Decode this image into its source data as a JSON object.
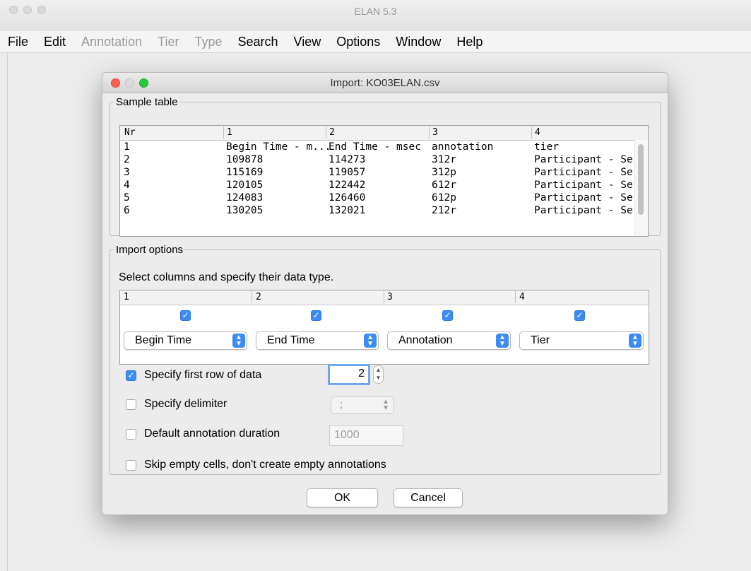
{
  "window": {
    "title": "ELAN 5.3",
    "menu": [
      {
        "label": "File",
        "enabled": true
      },
      {
        "label": "Edit",
        "enabled": true
      },
      {
        "label": "Annotation",
        "enabled": false
      },
      {
        "label": "Tier",
        "enabled": false
      },
      {
        "label": "Type",
        "enabled": false
      },
      {
        "label": "Search",
        "enabled": true
      },
      {
        "label": "View",
        "enabled": true
      },
      {
        "label": "Options",
        "enabled": true
      },
      {
        "label": "Window",
        "enabled": true
      },
      {
        "label": "Help",
        "enabled": true
      }
    ]
  },
  "dialog": {
    "title": "Import: KO03ELAN.csv",
    "sample_table": {
      "legend": "Sample table",
      "headers": [
        "Nr",
        "1",
        "2",
        "3",
        "4"
      ],
      "rows": [
        [
          "1",
          "Begin Time - m...",
          "End Time - msec",
          "annotation",
          "tier"
        ],
        [
          "2",
          "109878",
          "114273",
          "312r",
          "Participant - Se..."
        ],
        [
          "3",
          "115169",
          "119057",
          "312p",
          "Participant - Se..."
        ],
        [
          "4",
          "120105",
          "122442",
          "612r",
          "Participant - Se..."
        ],
        [
          "5",
          "124083",
          "126460",
          "612p",
          "Participant - Se..."
        ],
        [
          "6",
          "130205",
          "132021",
          "212r",
          "Participant - Se..."
        ]
      ]
    },
    "import_options": {
      "legend": "Import options",
      "instruction": "Select columns and specify their data type.",
      "column_headers": [
        "1",
        "2",
        "3",
        "4"
      ],
      "columns": [
        {
          "checked": true,
          "type": "Begin Time"
        },
        {
          "checked": true,
          "type": "End Time"
        },
        {
          "checked": true,
          "type": "Annotation"
        },
        {
          "checked": true,
          "type": "Tier"
        }
      ],
      "first_row": {
        "label": "Specify first row of data",
        "checked": true,
        "value": "2"
      },
      "delimiter": {
        "label": "Specify delimiter",
        "checked": false,
        "value": ";"
      },
      "duration": {
        "label": "Default annotation duration",
        "checked": false,
        "value": "1000"
      },
      "skip_empty": {
        "label": "Skip empty cells, don't create empty annotations",
        "checked": false
      }
    },
    "buttons": {
      "ok": "OK",
      "cancel": "Cancel"
    }
  },
  "colors": {
    "accent": "#3b8cf5",
    "close": "#fe5f57",
    "minimize": "#febc2e",
    "zoom": "#28c840"
  }
}
